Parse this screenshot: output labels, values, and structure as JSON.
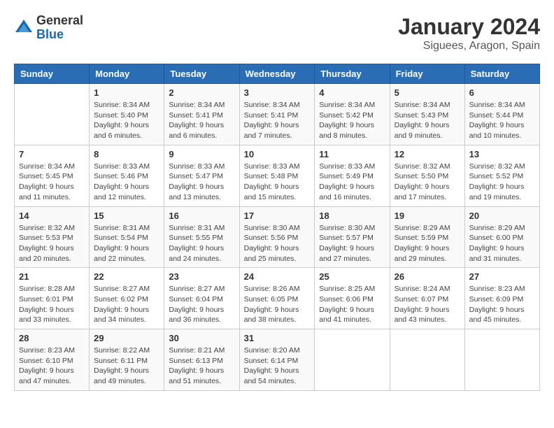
{
  "logo": {
    "general": "General",
    "blue": "Blue"
  },
  "title": {
    "month_year": "January 2024",
    "location": "Siguees, Aragon, Spain"
  },
  "weekdays": [
    "Sunday",
    "Monday",
    "Tuesday",
    "Wednesday",
    "Thursday",
    "Friday",
    "Saturday"
  ],
  "weeks": [
    [
      {
        "day": "",
        "info": ""
      },
      {
        "day": "1",
        "info": "Sunrise: 8:34 AM\nSunset: 5:40 PM\nDaylight: 9 hours\nand 6 minutes."
      },
      {
        "day": "2",
        "info": "Sunrise: 8:34 AM\nSunset: 5:41 PM\nDaylight: 9 hours\nand 6 minutes."
      },
      {
        "day": "3",
        "info": "Sunrise: 8:34 AM\nSunset: 5:41 PM\nDaylight: 9 hours\nand 7 minutes."
      },
      {
        "day": "4",
        "info": "Sunrise: 8:34 AM\nSunset: 5:42 PM\nDaylight: 9 hours\nand 8 minutes."
      },
      {
        "day": "5",
        "info": "Sunrise: 8:34 AM\nSunset: 5:43 PM\nDaylight: 9 hours\nand 9 minutes."
      },
      {
        "day": "6",
        "info": "Sunrise: 8:34 AM\nSunset: 5:44 PM\nDaylight: 9 hours\nand 10 minutes."
      }
    ],
    [
      {
        "day": "7",
        "info": "Sunrise: 8:34 AM\nSunset: 5:45 PM\nDaylight: 9 hours\nand 11 minutes."
      },
      {
        "day": "8",
        "info": "Sunrise: 8:33 AM\nSunset: 5:46 PM\nDaylight: 9 hours\nand 12 minutes."
      },
      {
        "day": "9",
        "info": "Sunrise: 8:33 AM\nSunset: 5:47 PM\nDaylight: 9 hours\nand 13 minutes."
      },
      {
        "day": "10",
        "info": "Sunrise: 8:33 AM\nSunset: 5:48 PM\nDaylight: 9 hours\nand 15 minutes."
      },
      {
        "day": "11",
        "info": "Sunrise: 8:33 AM\nSunset: 5:49 PM\nDaylight: 9 hours\nand 16 minutes."
      },
      {
        "day": "12",
        "info": "Sunrise: 8:32 AM\nSunset: 5:50 PM\nDaylight: 9 hours\nand 17 minutes."
      },
      {
        "day": "13",
        "info": "Sunrise: 8:32 AM\nSunset: 5:52 PM\nDaylight: 9 hours\nand 19 minutes."
      }
    ],
    [
      {
        "day": "14",
        "info": "Sunrise: 8:32 AM\nSunset: 5:53 PM\nDaylight: 9 hours\nand 20 minutes."
      },
      {
        "day": "15",
        "info": "Sunrise: 8:31 AM\nSunset: 5:54 PM\nDaylight: 9 hours\nand 22 minutes."
      },
      {
        "day": "16",
        "info": "Sunrise: 8:31 AM\nSunset: 5:55 PM\nDaylight: 9 hours\nand 24 minutes."
      },
      {
        "day": "17",
        "info": "Sunrise: 8:30 AM\nSunset: 5:56 PM\nDaylight: 9 hours\nand 25 minutes."
      },
      {
        "day": "18",
        "info": "Sunrise: 8:30 AM\nSunset: 5:57 PM\nDaylight: 9 hours\nand 27 minutes."
      },
      {
        "day": "19",
        "info": "Sunrise: 8:29 AM\nSunset: 5:59 PM\nDaylight: 9 hours\nand 29 minutes."
      },
      {
        "day": "20",
        "info": "Sunrise: 8:29 AM\nSunset: 6:00 PM\nDaylight: 9 hours\nand 31 minutes."
      }
    ],
    [
      {
        "day": "21",
        "info": "Sunrise: 8:28 AM\nSunset: 6:01 PM\nDaylight: 9 hours\nand 33 minutes."
      },
      {
        "day": "22",
        "info": "Sunrise: 8:27 AM\nSunset: 6:02 PM\nDaylight: 9 hours\nand 34 minutes."
      },
      {
        "day": "23",
        "info": "Sunrise: 8:27 AM\nSunset: 6:04 PM\nDaylight: 9 hours\nand 36 minutes."
      },
      {
        "day": "24",
        "info": "Sunrise: 8:26 AM\nSunset: 6:05 PM\nDaylight: 9 hours\nand 38 minutes."
      },
      {
        "day": "25",
        "info": "Sunrise: 8:25 AM\nSunset: 6:06 PM\nDaylight: 9 hours\nand 41 minutes."
      },
      {
        "day": "26",
        "info": "Sunrise: 8:24 AM\nSunset: 6:07 PM\nDaylight: 9 hours\nand 43 minutes."
      },
      {
        "day": "27",
        "info": "Sunrise: 8:23 AM\nSunset: 6:09 PM\nDaylight: 9 hours\nand 45 minutes."
      }
    ],
    [
      {
        "day": "28",
        "info": "Sunrise: 8:23 AM\nSunset: 6:10 PM\nDaylight: 9 hours\nand 47 minutes."
      },
      {
        "day": "29",
        "info": "Sunrise: 8:22 AM\nSunset: 6:11 PM\nDaylight: 9 hours\nand 49 minutes."
      },
      {
        "day": "30",
        "info": "Sunrise: 8:21 AM\nSunset: 6:13 PM\nDaylight: 9 hours\nand 51 minutes."
      },
      {
        "day": "31",
        "info": "Sunrise: 8:20 AM\nSunset: 6:14 PM\nDaylight: 9 hours\nand 54 minutes."
      },
      {
        "day": "",
        "info": ""
      },
      {
        "day": "",
        "info": ""
      },
      {
        "day": "",
        "info": ""
      }
    ]
  ]
}
